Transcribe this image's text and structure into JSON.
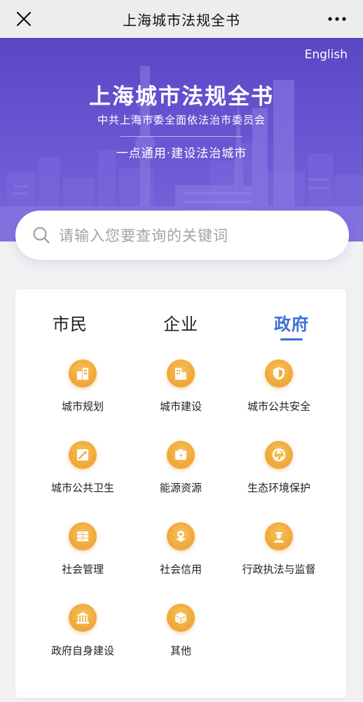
{
  "navbar": {
    "title": "上海城市法规全书",
    "close_icon": "close-icon",
    "more_icon": "more-icon"
  },
  "hero": {
    "language_link": "English",
    "title": "上海城市法规全书",
    "subtitle": "中共上海市委全面依法治市委员会",
    "slogan": "一点通用·建设法治城市"
  },
  "search": {
    "placeholder": "请输入您要查询的关键词"
  },
  "tabs": [
    {
      "label": "市民",
      "active": false
    },
    {
      "label": "企业",
      "active": false
    },
    {
      "label": "政府",
      "active": true
    }
  ],
  "categories": [
    {
      "label": "城市规划",
      "icon": "building-icon"
    },
    {
      "label": "城市建设",
      "icon": "construction-icon"
    },
    {
      "label": "城市公共安全",
      "icon": "shield-icon"
    },
    {
      "label": "城市公共卫生",
      "icon": "sanitation-icon"
    },
    {
      "label": "能源资源",
      "icon": "energy-icon"
    },
    {
      "label": "生态环境保护",
      "icon": "ecology-icon"
    },
    {
      "label": "社会管理",
      "icon": "management-icon"
    },
    {
      "label": "社会信用",
      "icon": "credit-icon"
    },
    {
      "label": "行政执法与监督",
      "icon": "officer-icon"
    },
    {
      "label": "政府自身建设",
      "icon": "government-icon"
    },
    {
      "label": "其他",
      "icon": "cube-icon"
    }
  ],
  "colors": {
    "accent": "#3d6fd6",
    "hero": "#5b46c6",
    "icon_orange": "#f0a93a"
  }
}
